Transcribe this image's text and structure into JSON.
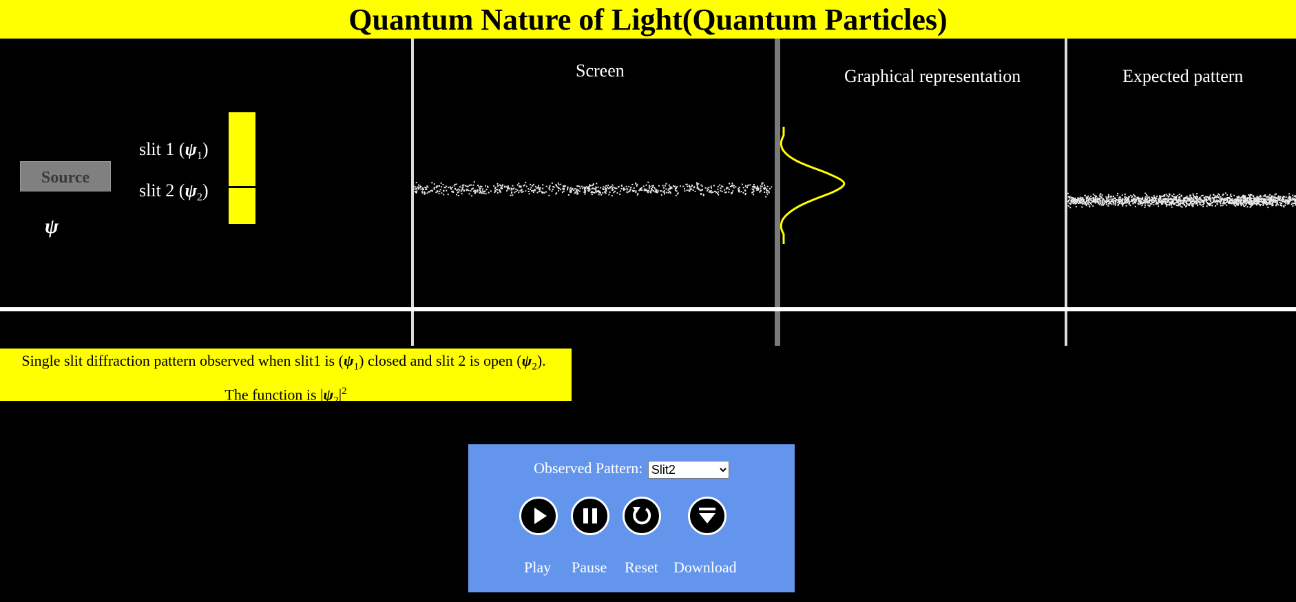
{
  "title": "Quantum Nature of Light(Quantum Particles)",
  "experiment": {
    "source_label": "Source",
    "psi_symbol": "ψ",
    "slit1": {
      "prefix": "slit 1 (",
      "psi": "ψ",
      "sub": "1",
      "suffix": ")"
    },
    "slit2": {
      "prefix": "slit 2 (",
      "psi": "ψ",
      "sub": "2",
      "suffix": ")"
    }
  },
  "sections": {
    "screen": "Screen",
    "graph": "Graphical representation",
    "expected": "Expected pattern"
  },
  "description": {
    "line1_a": "Single slit diffraction pattern observed when slit1 is (",
    "line1_psi1": "ψ",
    "line1_sub1": "1",
    "line1_b": ") closed and slit 2 is open (",
    "line1_psi2": "ψ",
    "line1_sub2": "2",
    "line1_c": ").",
    "line2_a": "The function is |",
    "line2_psi": "ψ",
    "line2_sub": "2",
    "line2_b": "|",
    "line2_sup": "2"
  },
  "controls": {
    "observed_label": "Observed Pattern:",
    "pattern_selected": "Slit2",
    "pattern_options": [
      "Slit2"
    ],
    "play_label": "Play",
    "pause_label": "Pause",
    "reset_label": "Reset",
    "download_label": "Download",
    "icons": [
      "play-icon",
      "pause-icon",
      "reset-icon",
      "download-icon"
    ]
  },
  "colors": {
    "yellow": "#ffff00",
    "panel": "#6495ed",
    "background": "#000000",
    "source": "#808080"
  }
}
